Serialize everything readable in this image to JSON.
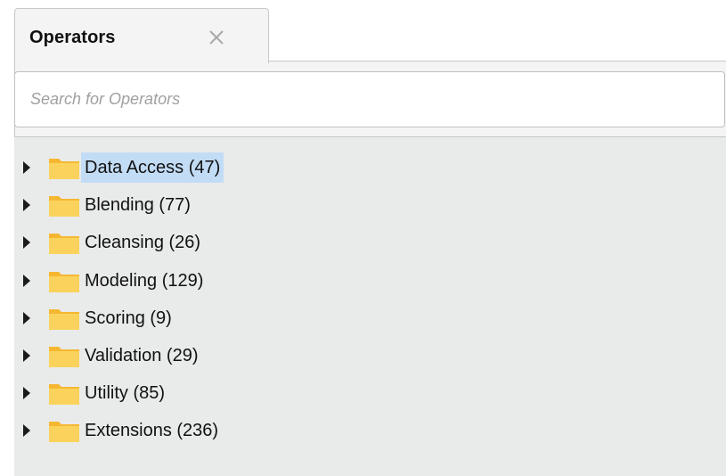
{
  "tab": {
    "title": "Operators",
    "close_glyph": "×"
  },
  "search": {
    "placeholder": "Search for Operators",
    "value": ""
  },
  "tree": {
    "items": [
      {
        "label": "Data Access (47)",
        "selected": true
      },
      {
        "label": "Blending (77)",
        "selected": false
      },
      {
        "label": "Cleansing (26)",
        "selected": false
      },
      {
        "label": "Modeling (129)",
        "selected": false
      },
      {
        "label": "Scoring (9)",
        "selected": false
      },
      {
        "label": "Validation (29)",
        "selected": false
      },
      {
        "label": "Utility (85)",
        "selected": false
      },
      {
        "label": "Extensions (236)",
        "selected": false
      }
    ]
  },
  "icons": {
    "expand": "chevron-right-icon",
    "folder": "folder-icon",
    "close": "close-icon"
  },
  "colors": {
    "selection": "#c2dcf6",
    "folder": "#f8c540",
    "tree_background": "#e9ebea"
  }
}
